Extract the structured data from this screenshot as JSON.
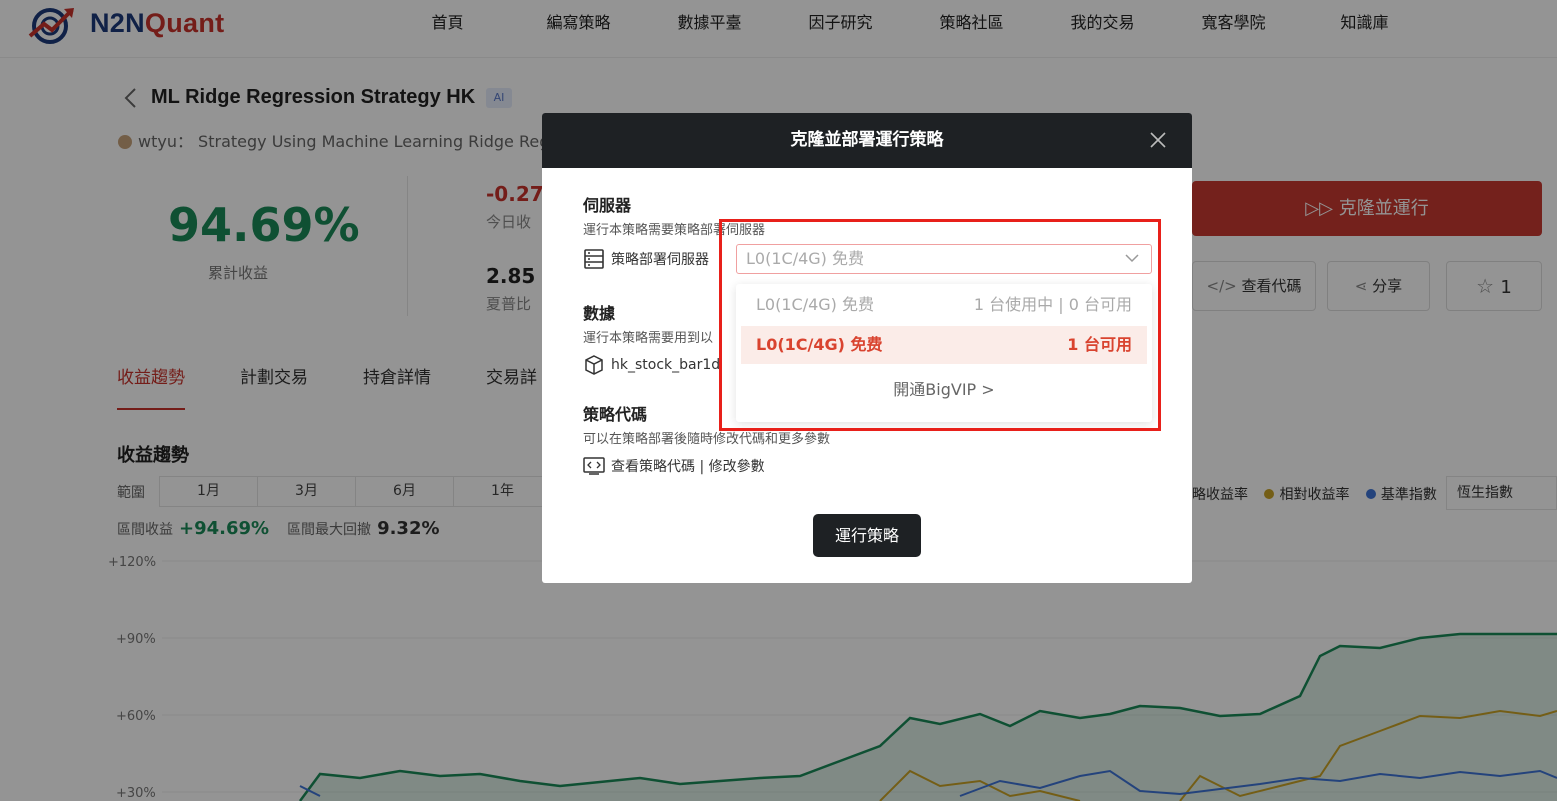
{
  "brand": {
    "part1": "N2N",
    "part2": "Quant"
  },
  "nav": [
    "首頁",
    "編寫策略",
    "數據平臺",
    "因子研究",
    "策略社區",
    "我的交易",
    "寬客學院",
    "知識庫"
  ],
  "strategy": {
    "title": "ML Ridge Regression Strategy HK",
    "badge": "AI",
    "author": "wtyu：  Strategy Using Machine Learning Ridge Regr"
  },
  "stats": {
    "cumulative_return": "94.69%",
    "cumulative_label": "累計收益",
    "today_value": "-0.27",
    "today_label": "今日收",
    "sharpe_value": "2.85",
    "sharpe_label": "夏普比"
  },
  "actions": {
    "clone_run": "克隆並運行",
    "view_code": "查看代碼",
    "share": "分享",
    "star_count": "1"
  },
  "tabs": [
    "收益趨勢",
    "計劃交易",
    "持倉詳情",
    "交易詳"
  ],
  "returns_section": {
    "title": "收益趨勢",
    "range_label": "範圍",
    "ranges": [
      "1月",
      "3月",
      "6月",
      "1年"
    ],
    "interval_return_label": "區間收益",
    "interval_return": "+94.69%",
    "max_drawdown_label": "區間最大回撤",
    "max_drawdown": "9.32%",
    "legend": [
      {
        "name": "略收益率",
        "color": "#1a8a58"
      },
      {
        "name": "相對收益率",
        "color": "#c9a227"
      },
      {
        "name": "基準指數",
        "color": "#3e74d6"
      }
    ],
    "index_select": "恆生指數",
    "y_ticks": [
      "+120%",
      "+90%",
      "+60%",
      "+30%"
    ]
  },
  "modal": {
    "title": "克隆並部署運行策略",
    "server": {
      "title": "伺服器",
      "desc": "運行本策略需要策略部署伺服器",
      "row_label": "策略部署伺服器",
      "select_value": "L0(1C/4G) 免费",
      "options": [
        {
          "label": "L0(1C/4G) 免费",
          "status": "1 台使用中 | 0 台可用",
          "disabled": true
        },
        {
          "label": "L0(1C/4G) 免费",
          "status": "1 台可用",
          "selected": true
        }
      ],
      "vip_link": "開通BigVIP"
    },
    "data": {
      "title": "數據",
      "desc": "運行本策略需要用到以",
      "item": "hk_stock_bar1d"
    },
    "code": {
      "title": "策略代碼",
      "desc": "可以在策略部署後隨時修改代碼和更多參數",
      "link": "查看策略代碼 | 修改參數"
    },
    "run_button": "運行策略"
  }
}
